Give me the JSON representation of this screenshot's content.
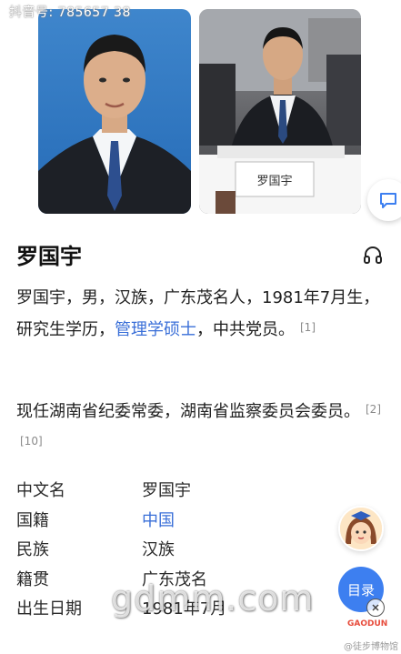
{
  "watermark_top": "抖音号: 785657      38",
  "photos": {
    "portrait_alt": "portrait",
    "meeting_nameplate": "罗国宇"
  },
  "profile": {
    "name": "罗国宇",
    "para1": {
      "text_a": "罗国宇，男，汉族，广东茂名人，1981年7月生，研究生学历，",
      "link": "管理学硕士",
      "text_b": "，中共党员。",
      "refs": [
        "[1]"
      ]
    },
    "para2": {
      "text": "现任湖南省纪委常委，湖南省监察委员会委员。",
      "refs": [
        "[2]",
        "[10]"
      ]
    }
  },
  "info": [
    {
      "label": "中文名",
      "value": "罗国宇",
      "link": false
    },
    {
      "label": "国籍",
      "value": "中国",
      "link": true
    },
    {
      "label": "民族",
      "value": "汉族",
      "link": false
    },
    {
      "label": "籍贯",
      "value": "广东茂名",
      "link": false
    },
    {
      "label": "出生日期",
      "value": "1981年7月",
      "link": false
    }
  ],
  "floating": {
    "toc_label": "目录"
  },
  "watermarks": {
    "center": "gdmm.com",
    "logo": "GAODUN",
    "bottom": "@徒步博物馆"
  },
  "colors": {
    "link": "#3a6fd8",
    "toc_button": "#3d7ff0"
  }
}
